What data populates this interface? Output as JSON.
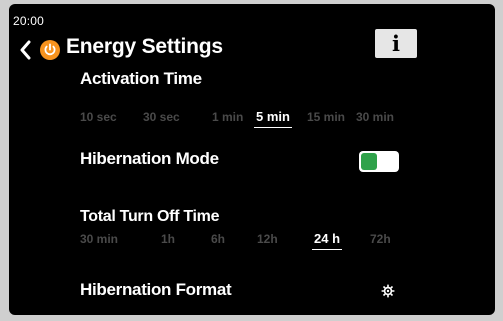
{
  "status_bar": {
    "time": "20:00"
  },
  "header": {
    "title": "Energy Settings",
    "info_label": "i"
  },
  "activation_time": {
    "title": "Activation Time",
    "options": [
      "10 sec",
      "30 sec",
      "1 min",
      "5 min",
      "15 min",
      "30 min"
    ],
    "selected": "5 min"
  },
  "hibernation_mode": {
    "title": "Hibernation Mode",
    "enabled": true
  },
  "total_turn_off_time": {
    "title": "Total Turn Off Time",
    "options": [
      "30 min",
      "1h",
      "6h",
      "12h",
      "24 h",
      "72h"
    ],
    "selected": "24 h"
  },
  "hibernation_format": {
    "title": "Hibernation Format"
  },
  "colors": {
    "accent_orange": "#f7931e",
    "toggle_green": "#2fa24a",
    "inactive_option": "#4a4a4a"
  }
}
